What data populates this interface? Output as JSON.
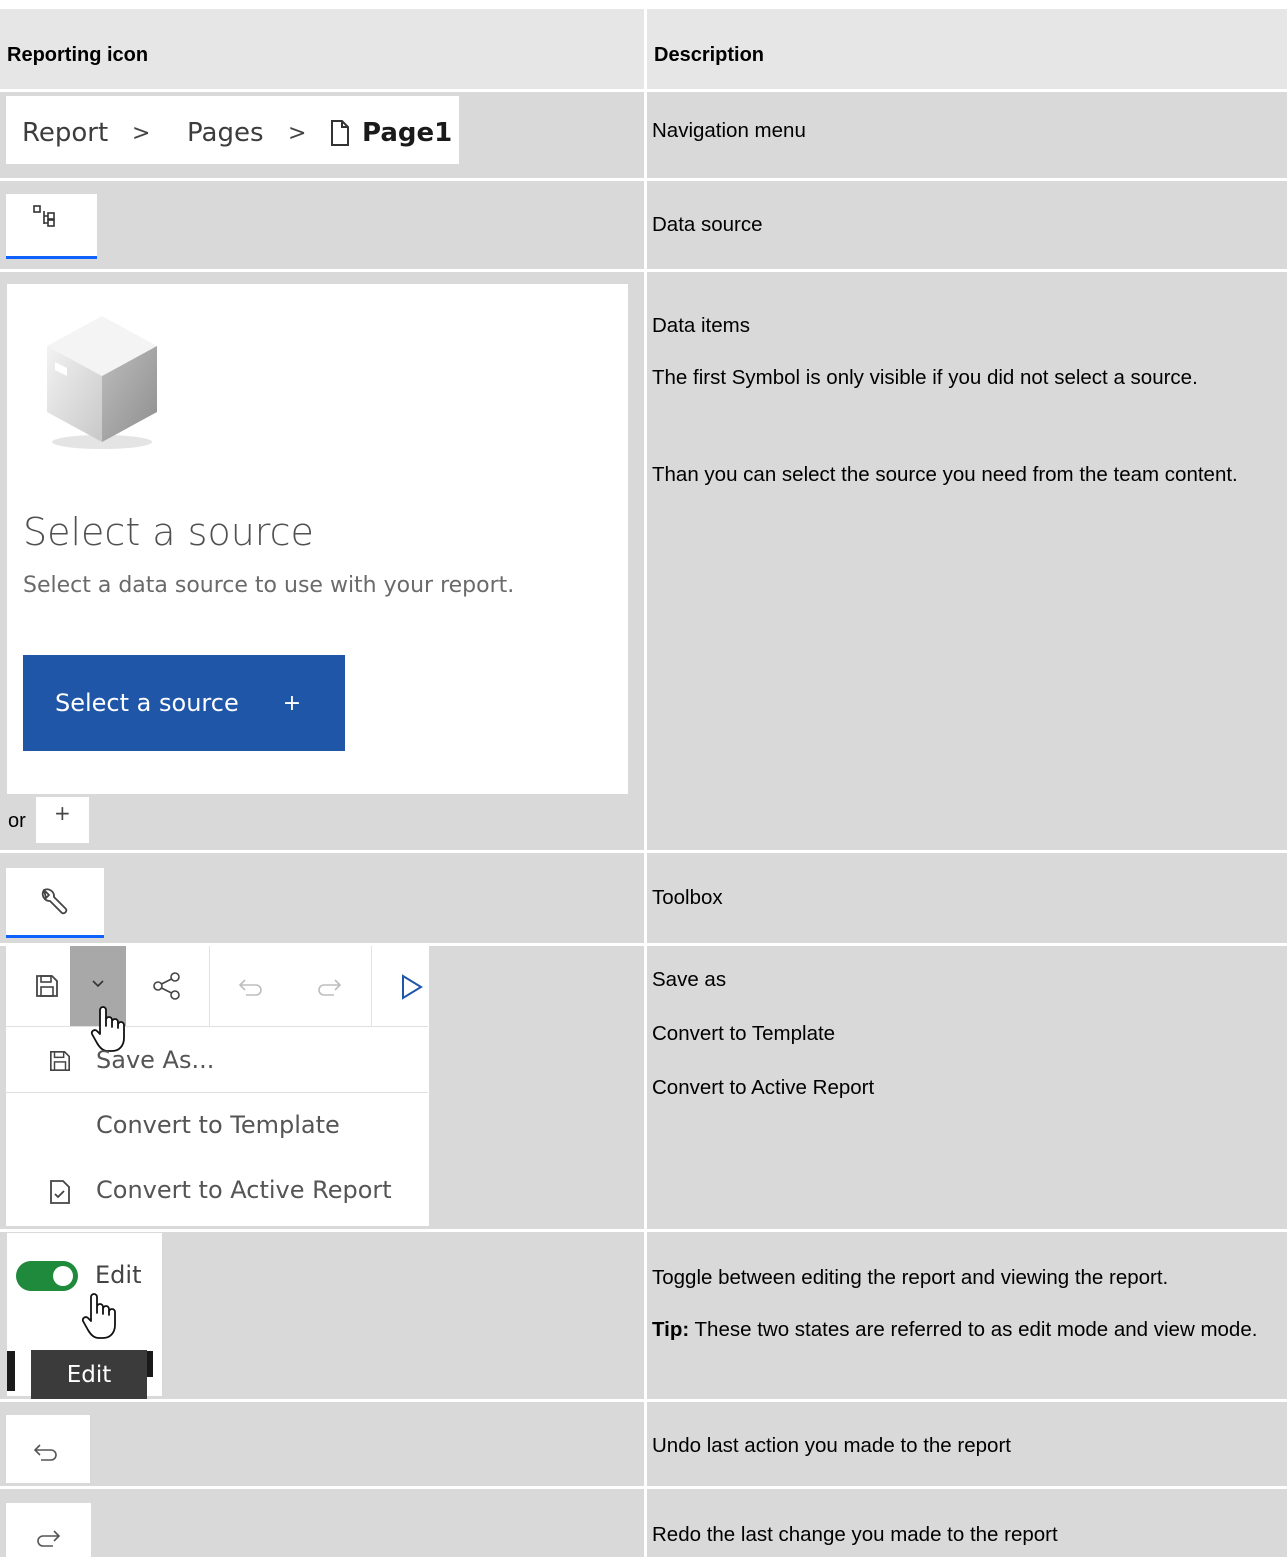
{
  "header": {
    "col1": "Reporting icon",
    "col2": "Description"
  },
  "rows": {
    "navigation": {
      "breadcrumb": [
        "Report",
        "Pages",
        "Page1"
      ],
      "separator": ">",
      "description": "Navigation menu"
    },
    "data_source": {
      "description": "Data source"
    },
    "data_items": {
      "placeholder_title": "Select a source",
      "placeholder_subtitle": "Select a data source to use with your report.",
      "button_label": "Select a source",
      "button_plus": "+",
      "or_text": "or",
      "small_plus": "+",
      "description_lines": [
        "Data items",
        "The first Symbol is only visible if you did not select a source.",
        "Than you can select the source you need from the team content."
      ]
    },
    "toolbox": {
      "description": "Toolbox"
    },
    "save_menu": {
      "menu_items": [
        "Save As...",
        "Convert to Template",
        "Convert to Active Report"
      ],
      "description_lines": [
        "Save as",
        "Convert to Template",
        "Convert to Active Report"
      ]
    },
    "edit_toggle": {
      "toggle_label": "Edit",
      "tooltip": "Edit",
      "description": "Toggle between editing the report and viewing the report.",
      "tip_label": "Tip:",
      "tip_text": " These two states are referred to as edit mode and view mode."
    },
    "undo": {
      "description": "Undo last action you made to the report"
    },
    "redo": {
      "description": "Redo the last change you made to the report"
    }
  },
  "colors": {
    "row_bg": "#d9d9d9",
    "header_bg": "#e6e6e6",
    "button_blue": "#1f56a8",
    "toggle_green": "#1f8a3c",
    "tab_underline": "#0f62fe"
  }
}
